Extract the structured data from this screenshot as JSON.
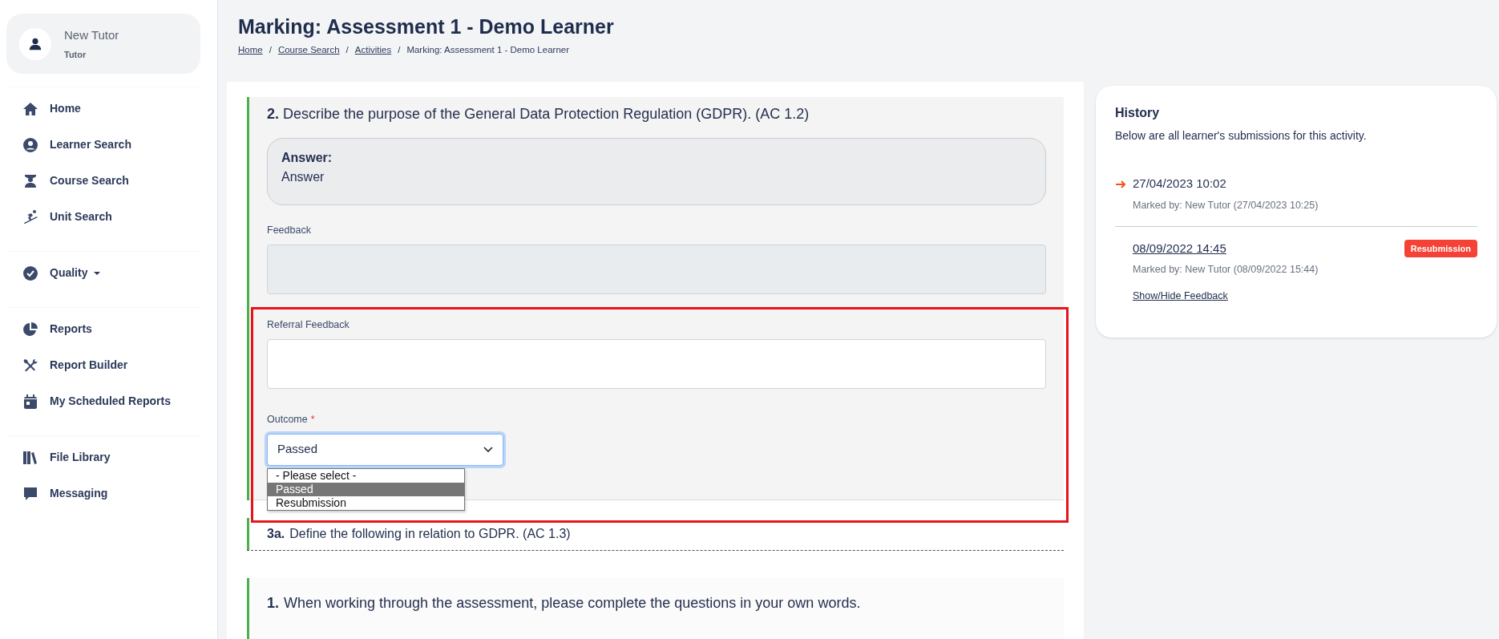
{
  "user": {
    "name": "New Tutor",
    "role": "Tutor"
  },
  "sidebar": {
    "groups": [
      {
        "items": [
          {
            "label": "Home",
            "has_menu": false
          },
          {
            "label": "Learner Search",
            "has_menu": false
          },
          {
            "label": "Course Search",
            "has_menu": false
          },
          {
            "label": "Unit Search",
            "has_menu": false
          }
        ]
      },
      {
        "items": [
          {
            "label": "Quality",
            "has_menu": true
          }
        ]
      },
      {
        "items": [
          {
            "label": "Reports",
            "has_menu": false
          },
          {
            "label": "Report Builder",
            "has_menu": false
          },
          {
            "label": "My Scheduled Reports",
            "has_menu": false
          }
        ]
      },
      {
        "items": [
          {
            "label": "File Library",
            "has_menu": false
          },
          {
            "label": "Messaging",
            "has_menu": false
          }
        ]
      }
    ]
  },
  "page": {
    "title": "Marking: Assessment 1 - Demo Learner",
    "breadcrumb": {
      "separator": "/",
      "items": [
        {
          "label": "Home",
          "link": true
        },
        {
          "label": "Course Search",
          "link": true
        },
        {
          "label": "Activities",
          "link": true
        },
        {
          "label": "Marking: Assessment 1 - Demo Learner",
          "link": false
        }
      ]
    }
  },
  "question": {
    "number": "2.",
    "text": "Describe the purpose of the General Data Protection Regulation (GDPR). (AC 1.2)",
    "answer": {
      "label": "Answer:",
      "text": "Answer"
    },
    "fields": [
      {
        "label": "Feedback",
        "disabled": true
      },
      {
        "label": "Referral Feedback",
        "disabled": false
      }
    ],
    "outcome": {
      "label": "Outcome",
      "required_mark": "*",
      "value": "Passed",
      "expanded": true,
      "options": [
        {
          "label": "- Please select -",
          "selected": false
        },
        {
          "label": "Passed",
          "selected": true
        },
        {
          "label": "Resubmission",
          "selected": false
        }
      ]
    }
  },
  "next_questions": [
    {
      "number": "3a.",
      "text": "Define the following in relation to GDPR. (AC 1.3)"
    },
    {
      "number": "1.",
      "text": "When working through the assessment, please complete the questions in your own words."
    }
  ],
  "history": {
    "title": "History",
    "subtitle": "Below are all learner's submissions for this activity.",
    "entries": [
      {
        "date": "27/04/2023 10:02",
        "current": true,
        "marked_by": "Marked by: New Tutor (27/04/2023 10:25)"
      },
      {
        "date": "08/09/2022 14:45",
        "current": false,
        "marked_by": "Marked by: New Tutor (08/09/2022 15:44)",
        "badge": "Resubmission",
        "toggle": "Show/Hide Feedback"
      }
    ]
  }
}
